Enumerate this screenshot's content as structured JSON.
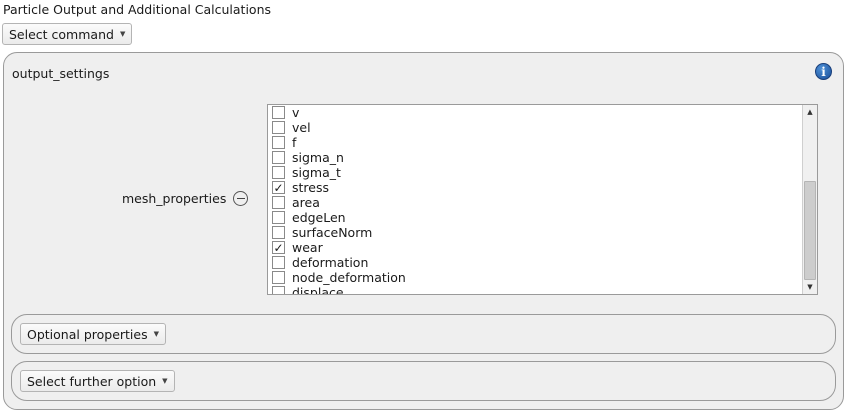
{
  "header": {
    "title": "Particle Output and Additional Calculations",
    "select_command_label": "Select command"
  },
  "output_settings": {
    "title": "output_settings",
    "info_icon": "info-icon",
    "mesh_properties": {
      "label": "mesh_properties",
      "remove_icon": "minus-circle-icon",
      "items": [
        {
          "label": "v",
          "checked": false
        },
        {
          "label": "vel",
          "checked": false
        },
        {
          "label": "f",
          "checked": false
        },
        {
          "label": "sigma_n",
          "checked": false
        },
        {
          "label": "sigma_t",
          "checked": false
        },
        {
          "label": "stress",
          "checked": true
        },
        {
          "label": "area",
          "checked": false
        },
        {
          "label": "edgeLen",
          "checked": false
        },
        {
          "label": "surfaceNorm",
          "checked": false
        },
        {
          "label": "wear",
          "checked": true
        },
        {
          "label": "deformation",
          "checked": false
        },
        {
          "label": "node_deformation",
          "checked": false
        },
        {
          "label": "displace",
          "checked": false
        }
      ]
    },
    "optional_properties_label": "Optional properties",
    "further_option_label": "Select further option"
  }
}
